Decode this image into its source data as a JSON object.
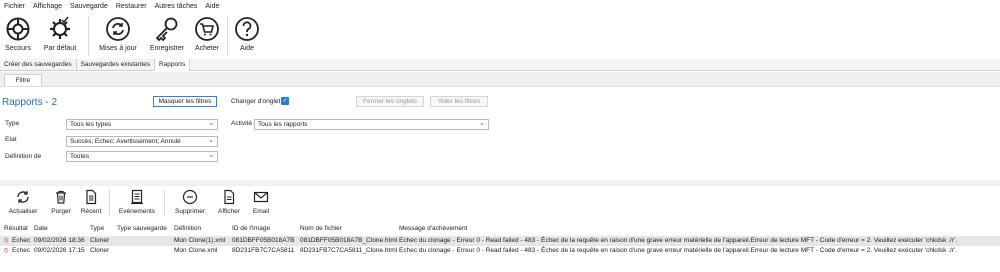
{
  "menu": [
    "Fichier",
    "Affichage",
    "Sauvegarde",
    "Restaurer",
    "Autres tâches",
    "Aide"
  ],
  "ribbon": {
    "secours": "Secours",
    "defaut": "Par défaut",
    "maj": "Mises à jour",
    "enregistrer": "Enregistrer",
    "acheter": "Acheter",
    "aide": "Aide"
  },
  "tabs": {
    "creer": "Créer des sauvegardes",
    "existantes": "Sauvegardes existantes",
    "rapports": "Rapports"
  },
  "filter_tab": "Filtre",
  "pane": {
    "title": "Rapports - 2",
    "masquer": "Masquer les filtres",
    "changer": "Changer d'onglet",
    "fermer": "Fermer les onglets",
    "vider": "Vider les filtres",
    "type_label": "Type",
    "type_value": "Tous les types",
    "etat_label": "Etat",
    "etat_value": "Succès; Echec; Avertissement; Annulé",
    "def_label": "Définition de",
    "def_value": "Toutes",
    "activite_label": "Activité",
    "activite_value": "Tous les rapports"
  },
  "toolbar": {
    "actualiser": "Actualiser",
    "purger": "Purger",
    "recent": "Récent",
    "evenements": "Evénements",
    "supprimer": "Supprimer",
    "afficher": "Afficher",
    "email": "Email"
  },
  "columns": {
    "resultat": "Résultat",
    "date": "Date",
    "type": "Type",
    "type_sauvegarde": "Type sauvegarde",
    "definition": "Définition",
    "id_image": "ID de l'Image",
    "nom_fichier": "Nom de fichier",
    "message": "Message d'achèvement"
  },
  "rows": [
    {
      "resultat": "Echec",
      "date": "09/02/2026 18:36",
      "type": "Cloner",
      "type_sauvegarde": "",
      "definition": "Mon Clone(1).xml",
      "id_image": "081DBFF05B018A7B",
      "nom_fichier": "081DBFF05B018A7B_Clone.html",
      "message": "Echec du clonage - Erreur 0 - Read failed - 483 - Échec de la requête en raison d'une grave erreur matérielle de l'appareil.Erreur de lecture MFT - Code d'erreur = 2.  Veuillez exécuter 'chkdsk :/r'."
    },
    {
      "resultat": "Echec",
      "date": "09/02/2026 17:15",
      "type": "Cloner",
      "type_sauvegarde": "",
      "definition": "Mon Clone.xml",
      "id_image": "8D231FB7C7CA5811",
      "nom_fichier": "8D231FB7C7CA5811_Clone.html",
      "message": "Echec du clonage - Erreur 0 - Read failed - 483 - Échec de la requête en raison d'une grave erreur matérielle de l'appareil.Erreur de lecture MFT - Code d'erreur = 2.  Veuillez exécuter 'chkdsk :/r'."
    }
  ]
}
